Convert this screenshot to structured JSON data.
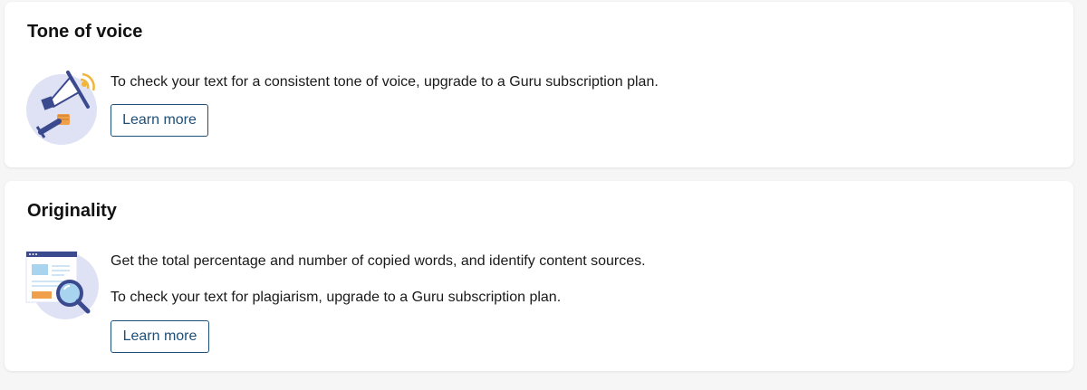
{
  "tone_of_voice": {
    "title": "Tone of voice",
    "description": "To check your text for a consistent tone of voice, upgrade to a Guru subscription plan.",
    "learn_more_label": "Learn more",
    "illustration_icon": "megaphone-icon"
  },
  "originality": {
    "title": "Originality",
    "description": "Get the total percentage and number of copied words, and identify content sources.",
    "upgrade_text": "To check your text for plagiarism, upgrade to a Guru subscription plan.",
    "learn_more_label": "Learn more",
    "illustration_icon": "document-magnifier-icon"
  },
  "colors": {
    "accent": "#1c4f7a",
    "illustration_bg": "#dfe2f5",
    "illustration_navy": "#3b4a8f",
    "illustration_orange": "#f0a04a",
    "illustration_blue": "#a8d4f0"
  }
}
